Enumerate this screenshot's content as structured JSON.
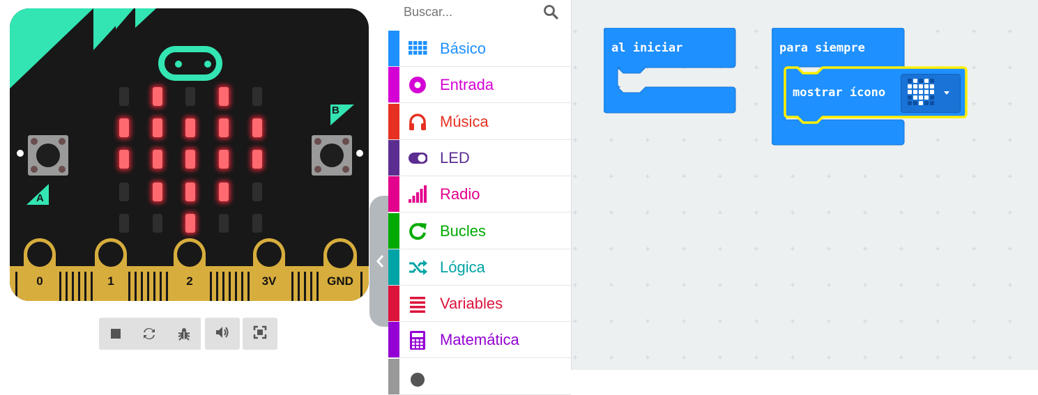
{
  "simulator": {
    "pins": [
      "0",
      "1",
      "2",
      "3V",
      "GND"
    ],
    "button_a_label": "A",
    "button_b_label": "B",
    "led_matrix": [
      [
        0,
        1,
        0,
        1,
        0
      ],
      [
        1,
        1,
        1,
        1,
        1
      ],
      [
        1,
        1,
        1,
        1,
        1
      ],
      [
        0,
        1,
        1,
        1,
        0
      ],
      [
        0,
        0,
        1,
        0,
        0
      ]
    ],
    "controls": [
      "stop-icon",
      "restart-icon",
      "debug-icon",
      "mute-icon",
      "fullscreen-icon"
    ]
  },
  "search": {
    "placeholder": "Buscar..."
  },
  "toolbox": {
    "categories": [
      {
        "label": "Básico",
        "color": "#1e90ff",
        "icon": "grid-icon"
      },
      {
        "label": "Entrada",
        "color": "#d400d4",
        "icon": "radio-button-icon"
      },
      {
        "label": "Música",
        "color": "#e63022",
        "icon": "headphones-icon"
      },
      {
        "label": "LED",
        "color": "#5c2d91",
        "icon": "toggle-icon"
      },
      {
        "label": "Radio",
        "color": "#e3008c",
        "icon": "signal-bars-icon"
      },
      {
        "label": "Bucles",
        "color": "#00aa00",
        "icon": "refresh-icon"
      },
      {
        "label": "Lógica",
        "color": "#00a4a6",
        "icon": "shuffle-icon"
      },
      {
        "label": "Variables",
        "color": "#dc143c",
        "icon": "list-icon"
      },
      {
        "label": "Matemática",
        "color": "#9400d3",
        "icon": "calculator-icon"
      }
    ]
  },
  "workspace": {
    "blocks": {
      "on_start": "al iniciar",
      "forever": "para siempre",
      "show_icon": "mostrar ícono",
      "show_icon_value": "heart"
    },
    "block_color": "#1e90ff",
    "highlight_color": "#ffef00"
  }
}
